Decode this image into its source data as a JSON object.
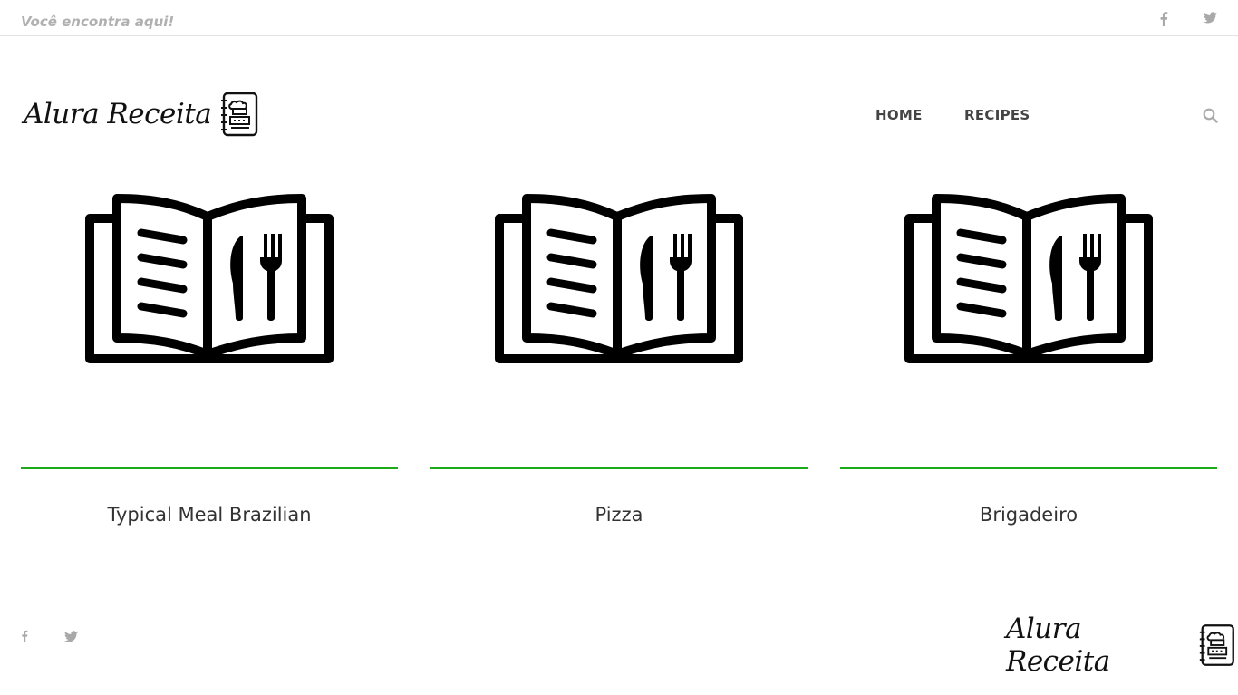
{
  "topbar": {
    "tagline": "Você encontra aqui!",
    "social": [
      "facebook-icon",
      "twitter-icon"
    ]
  },
  "header": {
    "logo_text": "Alura Receita",
    "logo_icon": "recipe-book-icon",
    "nav": [
      {
        "label": "HOME"
      },
      {
        "label": "RECIPES"
      }
    ],
    "search_icon": "search-icon"
  },
  "cards": [
    {
      "title": "Typical Meal Brazilian",
      "icon": "menu-book-icon"
    },
    {
      "title": "Pizza",
      "icon": "menu-book-icon"
    },
    {
      "title": "Brigadeiro",
      "icon": "menu-book-icon"
    }
  ],
  "footer": {
    "social": [
      "facebook-icon",
      "twitter-icon"
    ],
    "logo_text": "Alura Receita",
    "logo_icon": "recipe-book-icon"
  },
  "colors": {
    "accent_line": "#1aaa1a",
    "muted": "#b0b0b0",
    "text": "#333333"
  }
}
